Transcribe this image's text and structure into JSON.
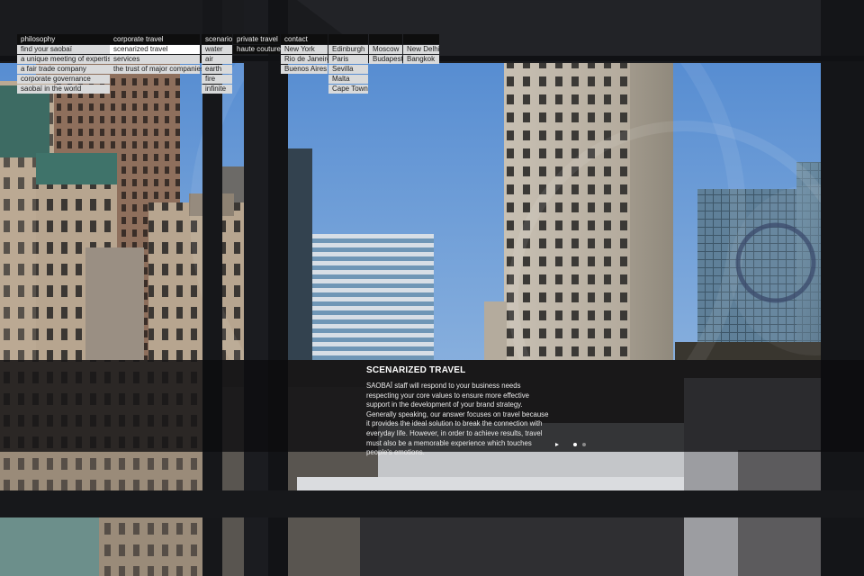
{
  "nav": {
    "philosophy": {
      "label": "philosophy",
      "items": [
        "find your saobaï",
        "a unique meeting of expertise",
        "a fair trade company",
        "corporate governance",
        "saobaï in the world"
      ]
    },
    "corporate_travel": {
      "label": "corporate travel",
      "items": [
        "scenarized travel",
        "services",
        "the trust of major companies"
      ]
    },
    "scenario": {
      "label": "scenario",
      "items": [
        "water",
        "air",
        "earth",
        "fire",
        "infinite"
      ]
    },
    "private_travel": {
      "label": "private travel",
      "items": [
        "haute couture"
      ]
    },
    "contact": {
      "label": "contact",
      "col1": [
        "New York",
        "Rio de Janeiro",
        "Buenos Aires"
      ],
      "col2": [
        "Edinburgh",
        "Paris",
        "Sevilla",
        "Malta",
        "Cape Town"
      ],
      "col3": [
        "Moscow",
        "Budapest"
      ],
      "col4": [
        "New Delhi",
        "Bangkok"
      ]
    }
  },
  "content": {
    "title": "SCENARIZED TRAVEL",
    "body": "SAOBAÏ staff will respond to your business needs respecting your core values to ensure more effective support in the development of your brand strategy. Generally speaking, our answer focuses on travel because it provides the ideal solution to break the connection with everyday life. However, in order to achieve results, travel must also be a memorable experience which touches people's emotions."
  },
  "slider": {
    "slide_count": 2,
    "active_slide": 1
  },
  "colors": {
    "sky": "#5f93cf",
    "band": "#0c0c0e",
    "menu_item": "#d9dadb",
    "menu_head": "#0e0e0e",
    "active_item": "#ffffff"
  }
}
